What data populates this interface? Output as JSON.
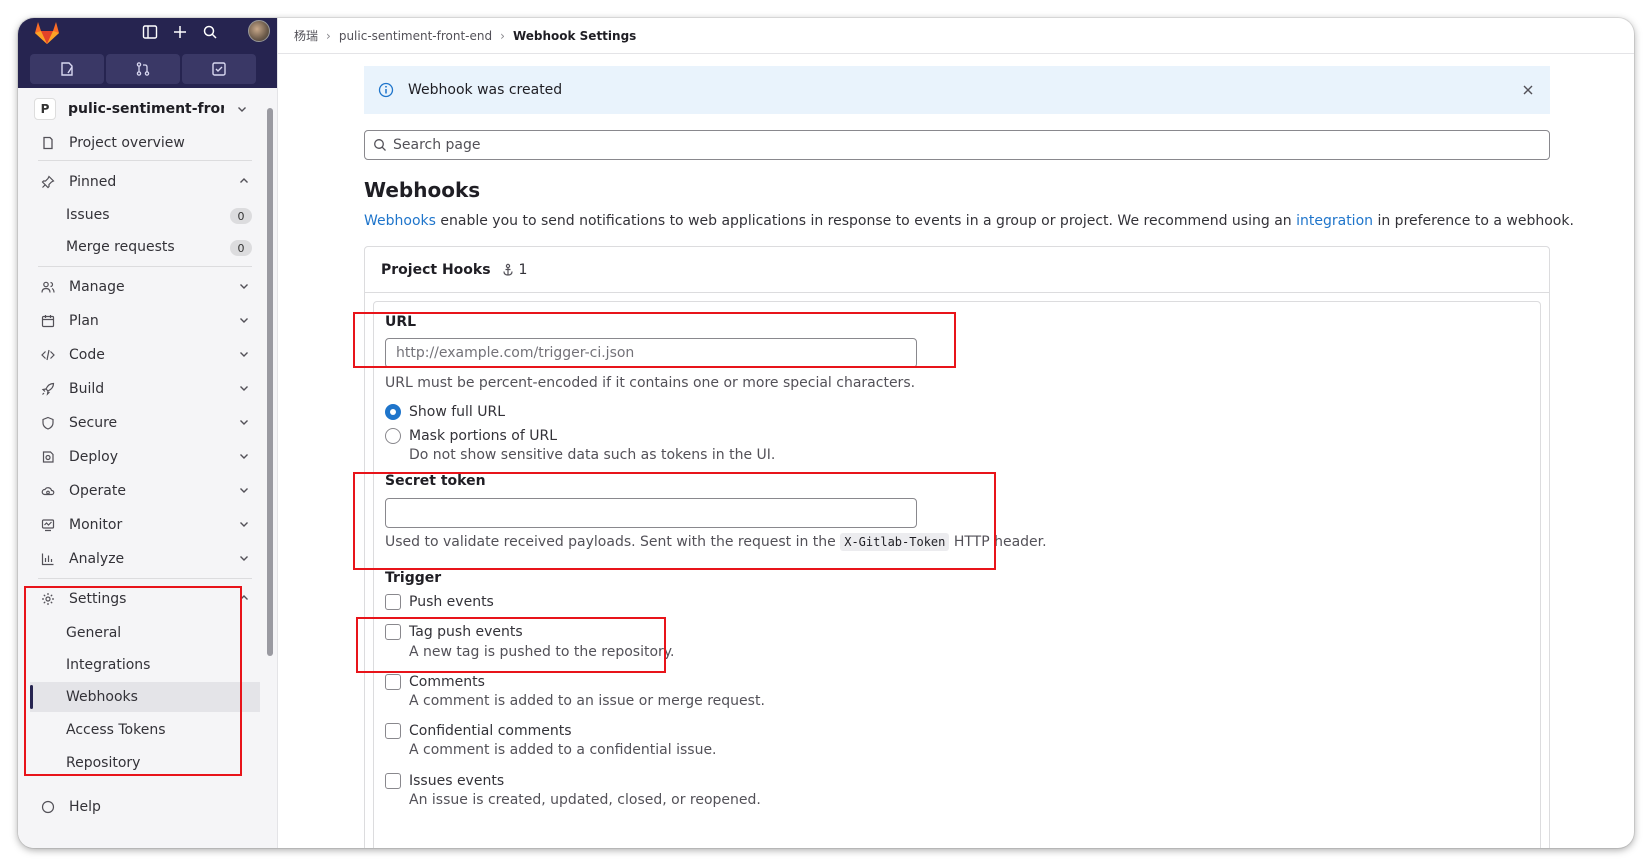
{
  "sidebar": {
    "project_badge": "P",
    "project_name": "pulic-sentiment-front...",
    "project_overview": "Project overview",
    "pinned": "Pinned",
    "pinned_items": [
      {
        "label": "Issues",
        "count": "0"
      },
      {
        "label": "Merge requests",
        "count": "0"
      }
    ],
    "nav": {
      "manage": "Manage",
      "plan": "Plan",
      "code": "Code",
      "build": "Build",
      "secure": "Secure",
      "deploy": "Deploy",
      "operate": "Operate",
      "monitor": "Monitor",
      "analyze": "Analyze",
      "settings": "Settings"
    },
    "settings_items": [
      "General",
      "Integrations",
      "Webhooks",
      "Access Tokens",
      "Repository"
    ],
    "help": "Help"
  },
  "breadcrumb": [
    "杨瑞",
    "pulic-sentiment-front-end",
    "Webhook Settings"
  ],
  "alert": {
    "text": "Webhook was created"
  },
  "search": {
    "placeholder": "Search page"
  },
  "page": {
    "title": "Webhooks",
    "desc_link1": "Webhooks",
    "desc_mid": " enable you to send notifications to web applications in response to events in a group or project. We recommend using an ",
    "desc_link2": "integration",
    "desc_end": " in preference to a webhook."
  },
  "card": {
    "title": "Project Hooks",
    "count": "1"
  },
  "form": {
    "url_label": "URL",
    "url_placeholder": "http://example.com/trigger-ci.json",
    "url_help": "URL must be percent-encoded if it contains one or more special characters.",
    "show_full_url": "Show full URL",
    "mask_url": "Mask portions of URL",
    "mask_help": "Do not show sensitive data such as tokens in the UI.",
    "secret_label": "Secret token",
    "secret_help_pre": "Used to validate received payloads. Sent with the request in the ",
    "secret_code": "X-Gitlab-Token",
    "secret_help_post": " HTTP header.",
    "trigger_label": "Trigger",
    "triggers": [
      {
        "label": "Push events",
        "help": ""
      },
      {
        "label": "Tag push events",
        "help": "A new tag is pushed to the repository."
      },
      {
        "label": "Comments",
        "help": "A comment is added to an issue or merge request."
      },
      {
        "label": "Confidential comments",
        "help": "A comment is added to a confidential issue."
      },
      {
        "label": "Issues events",
        "help": "An issue is created, updated, closed, or reopened."
      }
    ]
  },
  "colors": {
    "accent": "#1f75cb",
    "sidebar_top": "#262450",
    "highlight": "#e8141a"
  }
}
